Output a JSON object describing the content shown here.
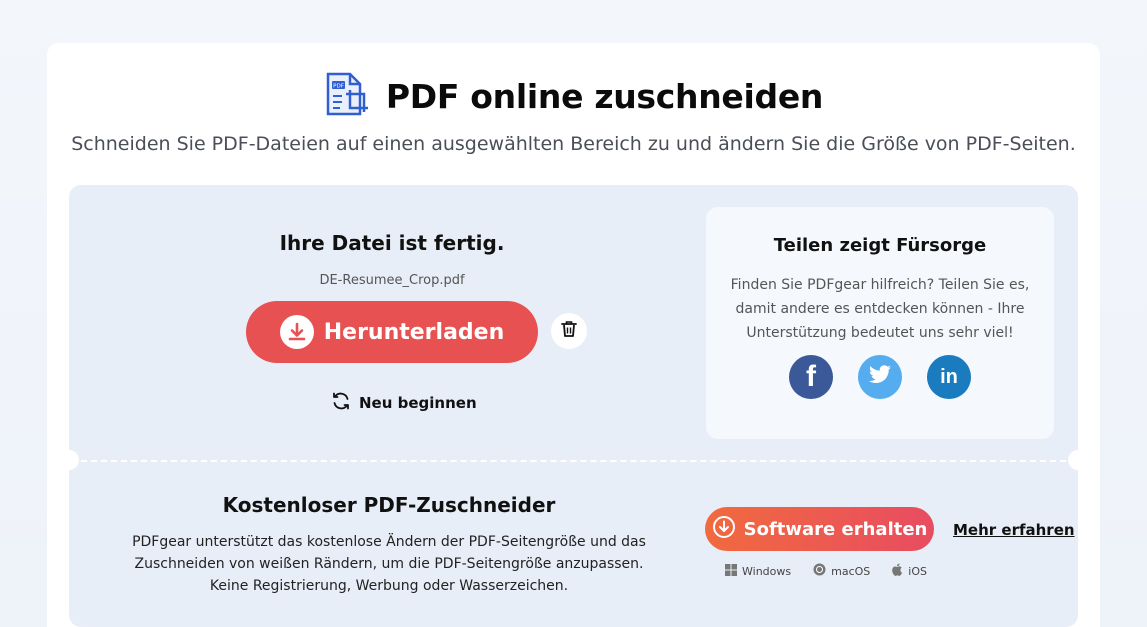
{
  "header": {
    "title": "PDF online zuschneiden",
    "subtitle": "Schneiden Sie PDF-Dateien auf einen ausgewählten Bereich zu und ändern Sie die Größe von PDF-Seiten.",
    "icon": "pdf-crop-icon"
  },
  "result": {
    "title": "Ihre Datei ist fertig.",
    "filename": "DE-Resumee_Crop.pdf",
    "download_label": "Herunterladen",
    "restart_label": "Neu beginnen"
  },
  "share": {
    "title": "Teilen zeigt Fürsorge",
    "text": "Finden Sie PDFgear hilfreich? Teilen Sie es, damit andere es entdecken können - Ihre Unterstützung bedeutet uns sehr viel!",
    "networks": [
      "facebook",
      "twitter",
      "linkedin"
    ]
  },
  "promo": {
    "title": "Kostenloser PDF-Zuschneider",
    "line1": "PDFgear unterstützt das kostenlose Ändern der PDF-Seitengröße und das",
    "line2": "Zuschneiden von weißen Rändern, um die PDF-Seitengröße anzupassen.",
    "line3": "Keine Registrierung, Werbung oder Wasserzeichen.",
    "get_software_label": "Software erhalten",
    "learn_more_label": "Mehr erfahren",
    "platforms": [
      "Windows",
      "macOS",
      "iOS"
    ]
  },
  "colors": {
    "download": "#e85151",
    "panel": "#e8eef8",
    "facebook": "#3b5998",
    "twitter": "#55acee",
    "linkedin": "#1a7bbf"
  }
}
